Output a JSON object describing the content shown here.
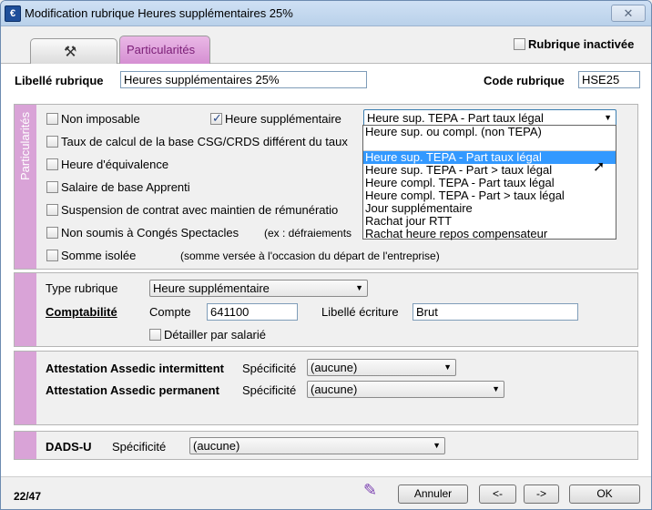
{
  "window": {
    "title": "Modification rubrique Heures supplémentaires 25%",
    "close_glyph": "✕",
    "app_glyph": "€"
  },
  "tabs": [
    {
      "icon": "tool-icon"
    },
    {
      "label": "Particularités"
    }
  ],
  "inactive": {
    "label": "Rubrique inactivée",
    "checked": false
  },
  "header": {
    "libelle_label": "Libellé rubrique",
    "libelle_value": "Heures supplémentaires 25%",
    "code_label": "Code rubrique",
    "code_value": "HSE25"
  },
  "particularites": {
    "side_label": "Particularités",
    "non_imposable": "Non imposable",
    "heure_sup": "Heure supplémentaire",
    "heure_sup_combo": "Heure sup. TEPA - Part taux légal",
    "taux_csg": "Taux de calcul de la base CSG/CRDS différent du taux",
    "heure_equiv": "Heure d'équivalence",
    "salaire_apprenti": "Salaire de base Apprenti",
    "suspension": "Suspension de contrat avec maintien de rémunératio",
    "conges": "Non soumis à Congés Spectacles",
    "conges_note": "(ex : défraiements",
    "somme": "Somme isolée",
    "somme_note": "(somme versée à l'occasion du départ de l'entreprise)"
  },
  "dropdown_options": [
    "Heure sup. ou compl. (non TEPA)",
    "",
    "Heure sup. TEPA - Part taux légal",
    "Heure sup. TEPA - Part > taux légal",
    "Heure compl. TEPA - Part taux légal",
    "Heure compl. TEPA - Part > taux légal",
    "Jour supplémentaire",
    "Rachat jour RTT",
    "Rachat heure repos compensateur"
  ],
  "type_section": {
    "type_label": "Type rubrique",
    "type_value": "Heure supplémentaire",
    "compta_label": "Comptabilité",
    "compte_label": "Compte",
    "compte_value": "641100",
    "libelle_ecriture_label": "Libellé écriture",
    "libelle_ecriture_value": "Brut",
    "detailler": "Détailler par salarié"
  },
  "assedic": {
    "intermittent_label": "Attestation Assedic intermittent",
    "permanent_label": "Attestation Assedic permanent",
    "specificite_label": "Spécificité",
    "intermittent_value": "(aucune)",
    "permanent_value": "(aucune)"
  },
  "dads": {
    "label": "DADS-U",
    "specificite_label": "Spécificité",
    "value": "(aucune)"
  },
  "footer": {
    "counter": "22/47",
    "cancel": "Annuler",
    "prev": "<-",
    "next": "->",
    "ok": "OK"
  }
}
